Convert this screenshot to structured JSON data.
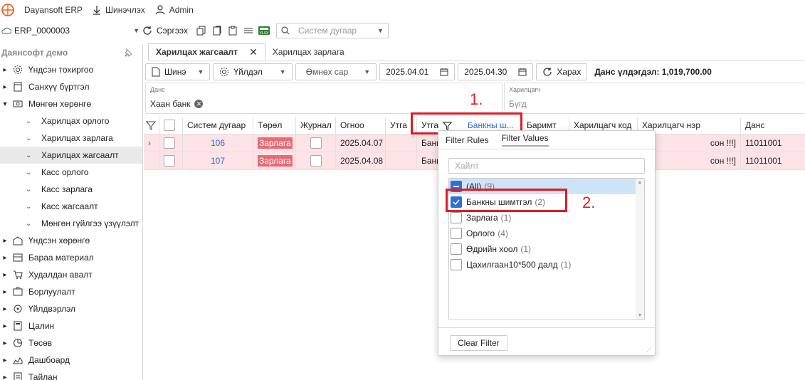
{
  "topbar": {
    "app_name": "Dayansoft ERP",
    "download_label": "Шинэчлэх",
    "user_label": "Admin"
  },
  "toolbar": {
    "company_code": "ERP_0000003",
    "refresh_label": "Сэргээх",
    "search_placeholder": "Систем дугаар"
  },
  "sidebar": {
    "header": "Даянсофт демо",
    "items": [
      {
        "label": "Үндсэн тохиргоо",
        "icon": "gear-icon"
      },
      {
        "label": "Санхүү бүртгэл",
        "icon": "ledger-icon"
      },
      {
        "label": "Мөнгөн хөрөнгө",
        "icon": "cash-icon"
      },
      {
        "label": "Харилцах орлого",
        "sub": true
      },
      {
        "label": "Харилцах зарлага",
        "sub": true
      },
      {
        "label": "Харилцах жагсаалт",
        "sub": true,
        "selected": true
      },
      {
        "label": "Касс орлого",
        "sub": true
      },
      {
        "label": "Касс зарлага",
        "sub": true
      },
      {
        "label": "Касс жагсаалт",
        "sub": true
      },
      {
        "label": "Мөнгөн гүйлгээ үзүүлэлт",
        "sub": true
      },
      {
        "label": "Үндсэн хөрөнгө",
        "icon": "asset-icon"
      },
      {
        "label": "Бараа материал",
        "icon": "inventory-icon"
      },
      {
        "label": "Худалдан авалт",
        "icon": "purchase-icon"
      },
      {
        "label": "Борлуулалт",
        "icon": "sales-icon"
      },
      {
        "label": "Үйлдвэрлэл",
        "icon": "factory-icon"
      },
      {
        "label": "Цалин",
        "icon": "calculator-icon"
      },
      {
        "label": "Төсөв",
        "icon": "budget-icon"
      },
      {
        "label": "Дашбоард",
        "icon": "dashboard-icon"
      },
      {
        "label": "Тайлан",
        "icon": "report-icon"
      }
    ]
  },
  "tabs": [
    {
      "label": "Харилцах жагсаалт",
      "active": true
    },
    {
      "label": "Харилцах зарлага"
    }
  ],
  "filters": {
    "new_label": "Шинэ",
    "action_label": "Үйлдэл",
    "period_label": "Өмнөх сар",
    "date_from": "2025.04.01",
    "date_to": "2025.04.30",
    "view_label": "Харах",
    "balance": "Данс үлдэгдэл: 1,019,700.00",
    "account_label": "Данс",
    "account_value": "Хаан банк",
    "partner_label": "Харилцагч",
    "partner_placeholder": "Бүгд"
  },
  "grid": {
    "headers": [
      "Систем дугаар",
      "Төрөл",
      "Журнал",
      "Огноо",
      "Утга",
      "Утга",
      "Банкны ш...",
      "Баримт",
      "Харилцагч код",
      "Харилцагч нэр",
      "Данс"
    ],
    "rows": [
      {
        "sys": "106",
        "type": "Зарлага",
        "date": "2025.04.07",
        "utga": "Банк",
        "partner_name": "сон !!!]",
        "account": "11011001"
      },
      {
        "sys": "107",
        "type": "Зарлага",
        "date": "2025.04.08",
        "utga": "Банк",
        "partner_name": "сон !!!]",
        "account": "11011001"
      }
    ]
  },
  "filter_popup": {
    "tab_rules": "Filter Rules",
    "tab_values": "Filter Values",
    "search_placeholder": "Хайлт",
    "items": [
      {
        "label": "(All)",
        "count": "(9)",
        "state": "indeterminate"
      },
      {
        "label": "Банкны шимтгэл",
        "count": "(2)",
        "state": "checked"
      },
      {
        "label": "Зарлага",
        "count": "(1)",
        "state": "unchecked"
      },
      {
        "label": "Орлого",
        "count": "(4)",
        "state": "unchecked"
      },
      {
        "label": "Өдрийн хоол",
        "count": "(1)",
        "state": "unchecked"
      },
      {
        "label": "Цахилгаан10*500 далд",
        "count": "(1)",
        "state": "unchecked"
      }
    ],
    "clear_label": "Clear Filter"
  },
  "annotations": {
    "step1": "1.",
    "step2": "2.",
    "color": "#e01b24"
  }
}
